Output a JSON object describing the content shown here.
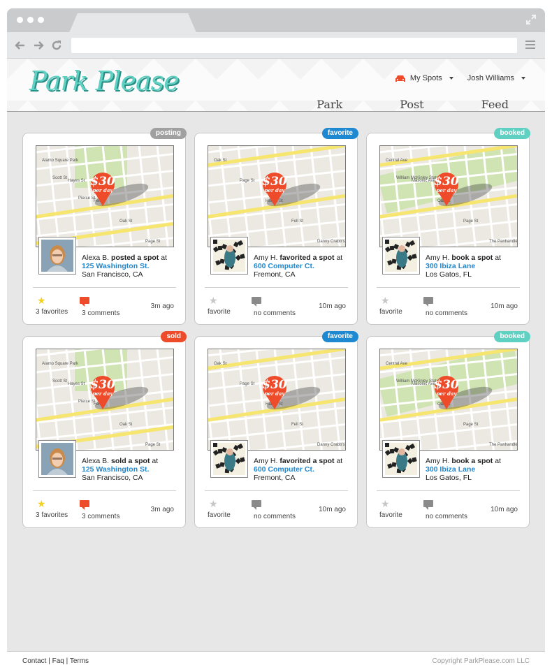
{
  "site": {
    "logo": "Park Please",
    "top_links": {
      "my_spots": "My Spots",
      "user": "Josh Williams"
    },
    "nav": [
      "Park",
      "Post",
      "Feed"
    ]
  },
  "colors": {
    "accent": "#5fd0c2",
    "posting": "#a0a0a0",
    "favorite": "#1e88d0",
    "booked": "#5fd0c2",
    "sold": "#ee4b2b",
    "price_pin": "#ee4b2b",
    "link": "#1e88d0"
  },
  "price": {
    "amount": "$30",
    "unit": "per day"
  },
  "cards": [
    {
      "badge": "posting",
      "badge_color": "#a0a0a0",
      "user": "Alexa B.",
      "action": "posted a spot",
      "at": "at",
      "address": "125 Washington St.",
      "city": "San Francisco, CA",
      "fav_label": "3 favorites",
      "fav_active": true,
      "comments": "3 comments",
      "com_active": true,
      "time": "3m ago",
      "map": "city",
      "avatar": "photo"
    },
    {
      "badge": "favorite",
      "badge_color": "#1e88d0",
      "user": "Amy H.",
      "action": "favorited a spot",
      "at": "at",
      "address": "600 Computer Ct.",
      "city": "Fremont, CA",
      "fav_label": "favorite",
      "fav_active": false,
      "comments": "no comments",
      "com_active": false,
      "time": "10m ago",
      "map": "grid",
      "avatar": "art"
    },
    {
      "badge": "booked",
      "badge_color": "#5fd0c2",
      "user": "Amy H.",
      "action": "book a spot",
      "at": "at",
      "address": "300 Ibiza Lane",
      "city": "Los Gatos, FL",
      "fav_label": "favorite",
      "fav_active": false,
      "comments": "no comments",
      "com_active": false,
      "time": "10m ago",
      "map": "park",
      "avatar": "art"
    },
    {
      "badge": "sold",
      "badge_color": "#ee4b2b",
      "user": "Alexa B.",
      "action": "sold a spot",
      "at": "at",
      "address": "125 Washington St.",
      "city": "San Francisco, CA",
      "fav_label": "3 favorites",
      "fav_active": true,
      "comments": "3 comments",
      "com_active": true,
      "time": "3m ago",
      "map": "city",
      "avatar": "photo"
    },
    {
      "badge": "favorite",
      "badge_color": "#1e88d0",
      "user": "Amy H.",
      "action": "favorited a spot",
      "at": "at",
      "address": "600 Computer Ct.",
      "city": "Fremont, CA",
      "fav_label": "favorite",
      "fav_active": false,
      "comments": "no comments",
      "com_active": false,
      "time": "10m ago",
      "map": "grid",
      "avatar": "art"
    },
    {
      "badge": "booked",
      "badge_color": "#5fd0c2",
      "user": "Amy H.",
      "action": "book a spot",
      "at": "at",
      "address": "300 Ibiza Lane",
      "city": "Los Gatos, FL",
      "fav_label": "favorite",
      "fav_active": false,
      "comments": "no comments",
      "com_active": false,
      "time": "10m ago",
      "map": "park",
      "avatar": "art"
    }
  ],
  "map_labels": {
    "city": [
      "Alamo Square Park",
      "Hayes St",
      "Fell St",
      "Oak St",
      "Page St",
      "Scott St",
      "Pierce St"
    ],
    "grid": [
      "Oak St",
      "Page St",
      "Haight St",
      "Fell St",
      "Danny Crabb's"
    ],
    "park": [
      "Central Ave",
      "Masonic Ave",
      "Oak St",
      "Page St",
      "The Panhandle",
      "William McKinley Statue"
    ]
  },
  "footer": {
    "links": "Contact  |  Faq  |  Terms",
    "copyright": "Copyright ParkPlease.com LLC"
  }
}
